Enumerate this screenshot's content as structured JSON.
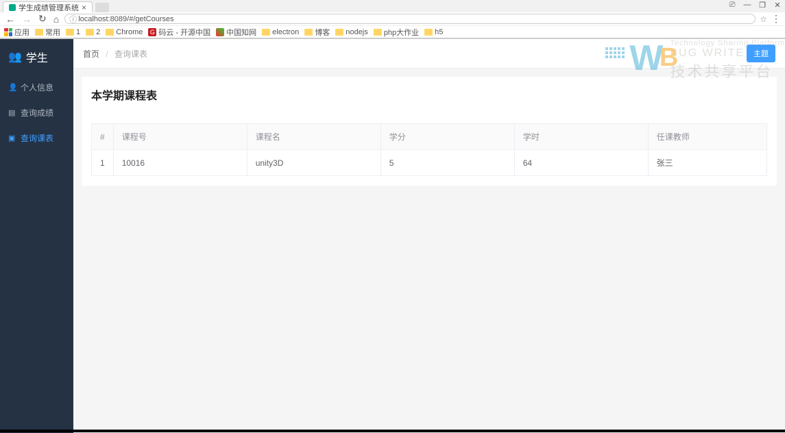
{
  "browser": {
    "tab_title": "学生成绩管理系统",
    "url": "localhost:8089/#/getCourses",
    "bookmarks": {
      "apps": "应用",
      "items": [
        "常用",
        "1",
        "2",
        "Chrome"
      ],
      "gitee": "码云 - 开源中国",
      "cnki": "中国知网",
      "folders2": [
        "electron",
        "博客",
        "nodejs",
        "php大作业",
        "h5"
      ]
    }
  },
  "sidebar": {
    "title": "学生",
    "items": [
      {
        "icon": "user-icon",
        "label": "个人信息"
      },
      {
        "icon": "list-icon",
        "label": "查询成绩"
      },
      {
        "icon": "book-icon",
        "label": "查询课表"
      }
    ]
  },
  "breadcrumb": {
    "home": "首页",
    "current": "查询课表",
    "theme_btn": "主题"
  },
  "card": {
    "title": "本学期课程表"
  },
  "table": {
    "headers": [
      "#",
      "课程号",
      "课程名",
      "学分",
      "学时",
      "任课教师"
    ],
    "rows": [
      {
        "idx": "1",
        "cno": "10016",
        "cname": "unity3D",
        "credit": "5",
        "hours": "64",
        "teacher": "张三"
      }
    ]
  },
  "watermark": {
    "en": "Technology Sharing Platform",
    "bw": "BUG WRITE",
    "cn": "技术共享平台"
  }
}
